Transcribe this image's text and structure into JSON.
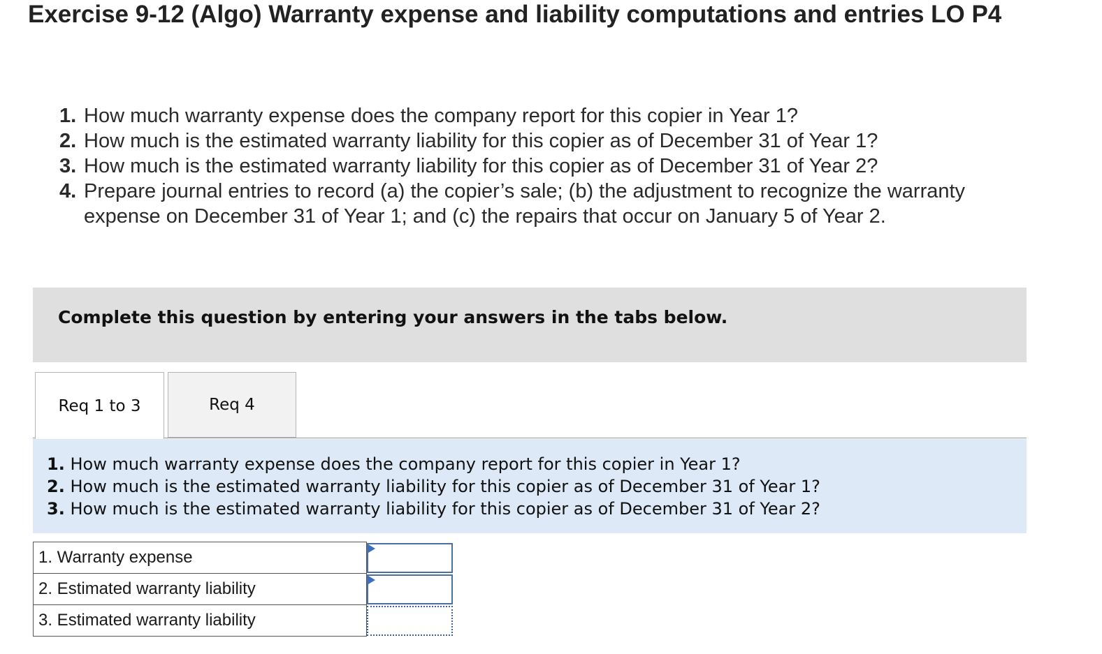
{
  "header": {
    "title": "Exercise 9-12 (Algo) Warranty expense and liability computations and entries LO P4"
  },
  "questions": [
    {
      "num": "1.",
      "text": "How much warranty expense does the company report for this copier in Year 1?"
    },
    {
      "num": "2.",
      "text": "How much is the estimated warranty liability for this copier as of December 31 of Year 1?"
    },
    {
      "num": "3.",
      "text": "How much is the estimated warranty liability for this copier as of December 31 of Year 2?"
    },
    {
      "num": "4.",
      "text": "Prepare journal entries to record (a) the copier’s sale; (b) the adjustment to recognize the warranty expense on December 31 of Year 1; and (c) the repairs that occur on January 5 of Year 2."
    }
  ],
  "instruction": "Complete this question by entering your answers in the tabs below.",
  "tabs": [
    {
      "label": "Req 1 to 3",
      "active": true
    },
    {
      "label": "Req 4",
      "active": false
    }
  ],
  "panel": {
    "items": [
      {
        "num": "1.",
        "text": "How much warranty expense does the company report for this copier in Year 1?"
      },
      {
        "num": "2.",
        "text": "How much is the estimated warranty liability for this copier as of December 31 of Year 1?"
      },
      {
        "num": "3.",
        "text": "How much is the estimated warranty liability for this copier as of December 31 of Year 2?"
      }
    ]
  },
  "answers": {
    "rows": [
      {
        "label": "1. Warranty expense",
        "value": ""
      },
      {
        "label": "2. Estimated warranty liability",
        "value": ""
      },
      {
        "label": "3. Estimated warranty liability",
        "value": ""
      }
    ]
  },
  "colors": {
    "instruction_bg": "#dfdfdf",
    "panel_bg": "#dde9f7",
    "input_border": "#4a6fa5",
    "flag": "#3a6fc4"
  }
}
